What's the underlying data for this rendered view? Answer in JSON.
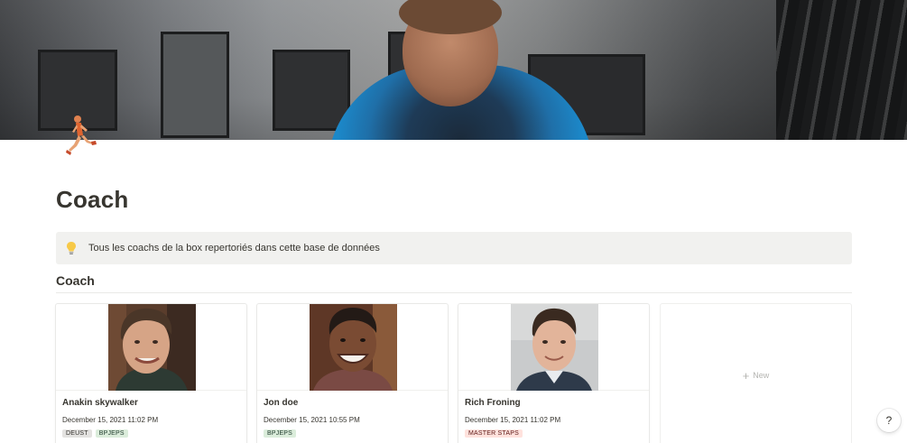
{
  "page": {
    "title": "Coach",
    "icon": "person-running-icon"
  },
  "callout": {
    "icon": "lightbulb-icon",
    "text": "Tous les coachs de la box repertoriés dans cette base de données"
  },
  "database": {
    "title": "Coach",
    "cards": [
      {
        "name": "Anakin skywalker",
        "date": "December 15, 2021 11:02 PM",
        "tags": [
          {
            "label": "DEUST",
            "color": "gray"
          },
          {
            "label": "BPJEPS",
            "color": "green"
          }
        ]
      },
      {
        "name": "Jon doe",
        "date": "December 15, 2021 10:55 PM",
        "tags": [
          {
            "label": "BPJEPS",
            "color": "green"
          }
        ]
      },
      {
        "name": "Rich Froning",
        "date": "December 15, 2021 11:02 PM",
        "tags": [
          {
            "label": "MASTER STAPS",
            "color": "red"
          }
        ]
      }
    ],
    "new_label": "New"
  },
  "help": {
    "label": "?"
  },
  "colors": {
    "text": "#37352f",
    "callout_bg": "#f1f1ef",
    "tag_gray": "#e3e2e0",
    "tag_green": "#dbeddb",
    "tag_red": "#ffe2dd"
  }
}
